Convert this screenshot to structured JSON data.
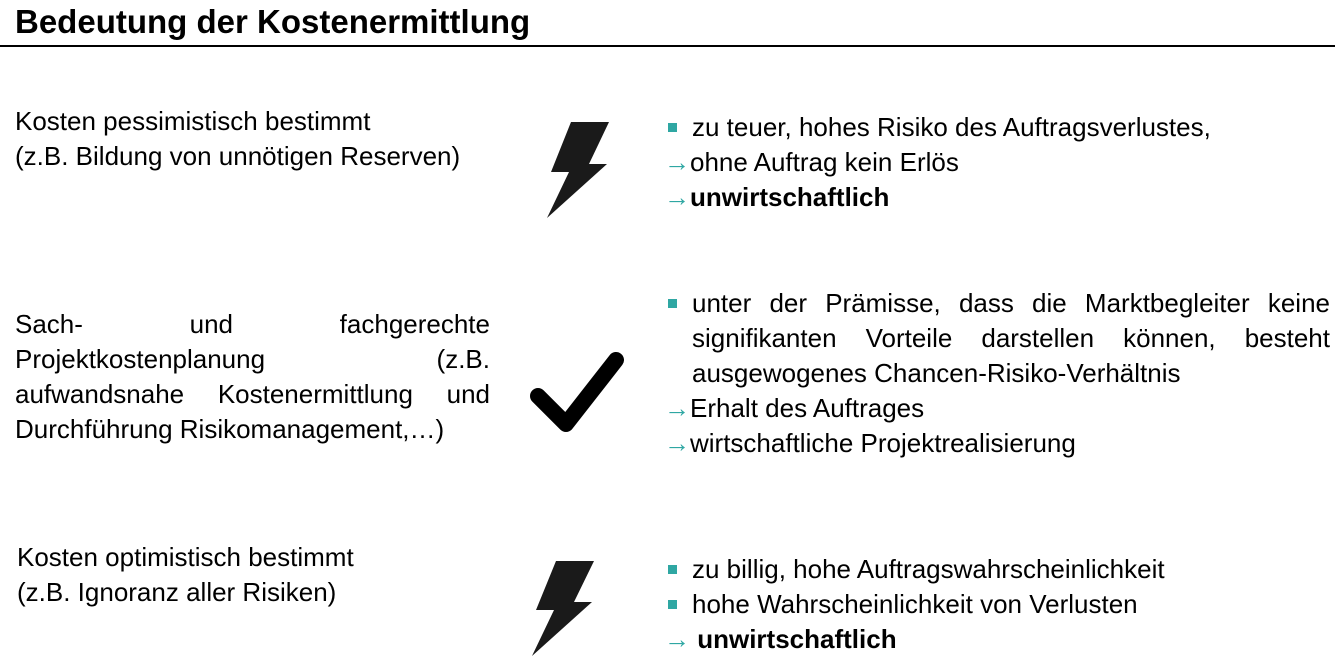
{
  "title": "Bedeutung der Kostenermittlung",
  "colors": {
    "accent": "#2fa7a3",
    "icon": "#1a1a1a"
  },
  "rows": [
    {
      "left_lines": [
        "Kosten pessimistisch bestimmt",
        "(z.B. Bildung von unnötigen Reserven)"
      ],
      "icon": "lightning-icon",
      "bullets": [
        "zu teuer, hohes Risiko des Auftragsverlustes,"
      ],
      "arrows": [
        {
          "symbol": "→",
          "text": "ohne Auftrag kein Erlös",
          "bold": false
        },
        {
          "symbol": "→",
          "text": "unwirtschaftlich",
          "bold": true
        }
      ]
    },
    {
      "left_text": "Sach- und fachgerechte Projektkostenplanung (z.B. aufwandsnahe Kostenermittlung und Durchführung Risikomanagement,…)",
      "icon": "checkmark-icon",
      "bullets": [
        "unter der Prämisse, dass die Marktbegleiter keine signifikanten Vorteile darstellen können, besteht ausgewogenes Chancen-Risiko-Verhältnis"
      ],
      "arrows": [
        {
          "symbol": "→",
          "text": "Erhalt des Auftrages",
          "bold": false
        },
        {
          "symbol": "→",
          "text": "wirtschaftliche Projektrealisierung",
          "bold": false
        }
      ]
    },
    {
      "left_lines": [
        "Kosten optimistisch bestimmt",
        "(z.B. Ignoranz aller Risiken)"
      ],
      "icon": "lightning-icon",
      "bullets": [
        "zu billig, hohe Auftragswahrscheinlichkeit",
        "hohe Wahrscheinlichkeit von Verlusten"
      ],
      "arrows": [
        {
          "symbol": "→",
          "text": " unwirtschaftlich",
          "bold": true
        }
      ]
    }
  ]
}
